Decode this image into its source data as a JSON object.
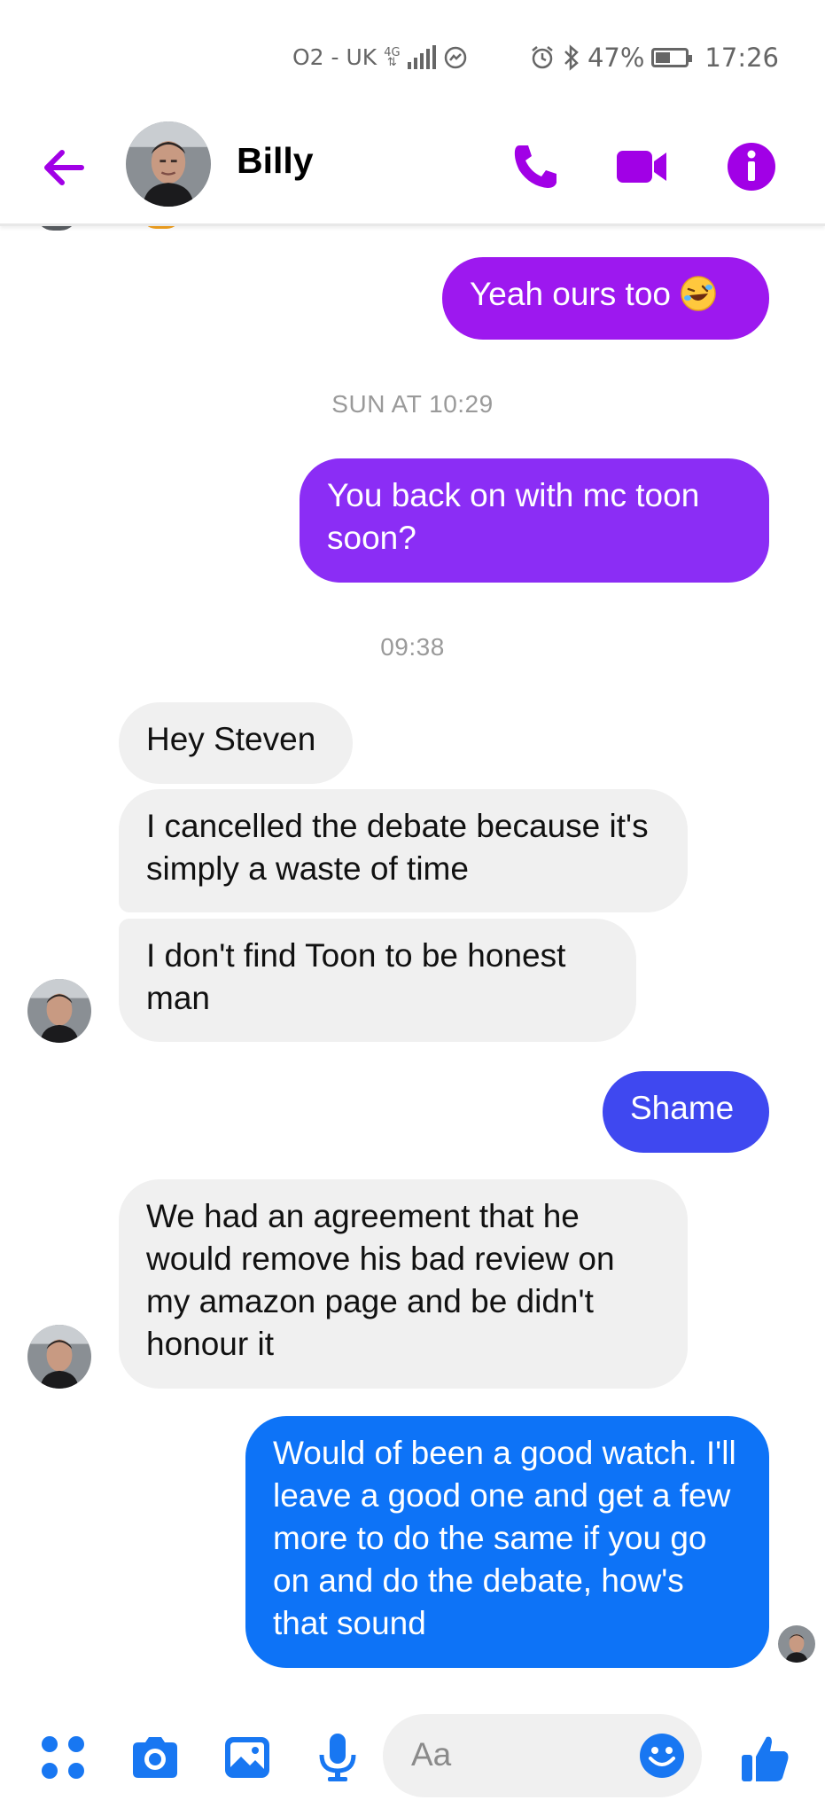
{
  "status_bar": {
    "carrier": "O2 - UK",
    "network": "4G",
    "battery_percent": "47%",
    "time": "17:26"
  },
  "header": {
    "contact_name": "Billy",
    "accent_color": "#a100e6",
    "icons": [
      "back-arrow-icon",
      "phone-icon",
      "video-camera-icon",
      "info-icon"
    ]
  },
  "conversation": {
    "timestamps": [
      "SUN AT 10:29",
      "09:38"
    ],
    "messages": [
      {
        "sender": "me",
        "text": "Yeah ours too",
        "emoji": "rolling-on-floor-laughing",
        "color": "#9d18ef"
      },
      {
        "sender": "me",
        "text": "You back on with mc toon soon?",
        "color": "#8b2df5"
      },
      {
        "sender": "Billy",
        "text": "Hey Steven"
      },
      {
        "sender": "Billy",
        "text": "I cancelled the debate because it's simply a waste of time"
      },
      {
        "sender": "Billy",
        "text": "I don't find Toon to be honest man"
      },
      {
        "sender": "me",
        "text": "Shame",
        "color": "#3f48f0"
      },
      {
        "sender": "Billy",
        "text": "We had an agreement that he would remove his bad review on my amazon page and be didn't honour it"
      },
      {
        "sender": "me",
        "text": "Would of been a good watch. I'll leave a good one and get a few more to do the same if you go on and do the debate, how's that sound",
        "color": "#0d73f7"
      }
    ]
  },
  "composer": {
    "placeholder": "Aa",
    "accent_color": "#1877f2",
    "icons": [
      "apps-grid-icon",
      "camera-icon",
      "gallery-icon",
      "microphone-icon",
      "emoji-icon",
      "thumbs-up-icon"
    ]
  }
}
